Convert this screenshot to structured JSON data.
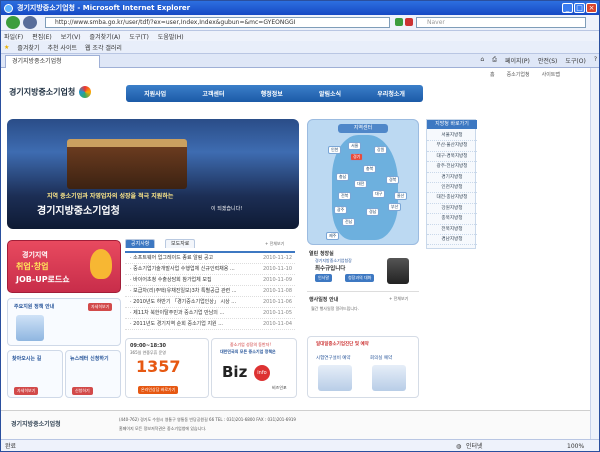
{
  "window": {
    "title": "경기지방중소기업청 - Microsoft Internet Explorer"
  },
  "address": {
    "url": "http://www.smba.go.kr/user/tdf/?ex=user,Index,Index&gubun=&mc=GYEONGGI",
    "search_placeholder": "Naver"
  },
  "menu": [
    "파일(F)",
    "편집(E)",
    "보기(V)",
    "즐겨찾기(A)",
    "도구(T)",
    "도움말(H)"
  ],
  "favbar": {
    "favorites": "즐겨찾기",
    "suggested": "추천 사이트",
    "webslice": "웹 조각 갤러리"
  },
  "tab": {
    "title": "경기지방중소기업청"
  },
  "ietools": [
    "페이지(P)",
    "안전(S)",
    "도구(O)"
  ],
  "page": {
    "toplinks": [
      "홈",
      "중소기업청",
      "사이트맵"
    ],
    "logo": "경기지방중소기업청",
    "gnb": [
      "지원사업",
      "고객센터",
      "행정정보",
      "알림소식",
      "우리청소개"
    ],
    "hero": {
      "caption1": "지역 중소기업과 자영업자의 성장을 적극 지원하는",
      "caption2": "경기지방중소기업청",
      "caption3": "이 되겠습니다!"
    },
    "map": {
      "title": "지역센터",
      "regions": [
        "인천",
        "서울",
        "경기",
        "강원",
        "충북",
        "충남",
        "대전",
        "전북",
        "대구",
        "경북",
        "부산",
        "광주",
        "전남",
        "제주",
        "울산",
        "경남"
      ]
    },
    "sidebar": {
      "title": "지방청 바로가기",
      "items": [
        "서울지방청",
        "부산·울산지방청",
        "대구·경북지방청",
        "광주·전남지방청",
        "경기지방청",
        "인천지방청",
        "대전·충남지방청",
        "강원지방청",
        "충북지방청",
        "전북지방청",
        "경남지방청"
      ]
    },
    "banner": {
      "line1": "경기지역",
      "line2": "취업·창업",
      "line3": "JOB-UP로드쇼"
    },
    "notice": {
      "tabs": [
        "공지사항",
        "보도자료"
      ],
      "more": "+ 전체보기",
      "rows": [
        {
          "title": "· 소프트웨어 업그레이드 종료 알림 공고",
          "date": "2010-11-12"
        },
        {
          "title": "· 중소기업기술개발사업 수행업체 신규인력채용 ...",
          "date": "2010-11-10"
        },
        {
          "title": "· 바이어초청 수출상담회 참가업체 모집",
          "date": "2010-11-09"
        },
        {
          "title": "· 보급차(리)주택(유채진일보)3차 특별공급 관련 ...",
          "date": "2010-11-08"
        },
        {
          "title": "· 2010년도 하반기 「경기중소기업인상」 시상 ...",
          "date": "2010-11-06"
        },
        {
          "title": "· 제11차 북한이탈주민과 중소기업 만남의 ...",
          "date": "2010-11-05"
        },
        {
          "title": "· 2011년도 경기지역 순회 중소기업 지원 ...",
          "date": "2010-11-04"
        }
      ]
    },
    "card1": {
      "title": "주요지원 정책 안내",
      "more": "자세히보기"
    },
    "card2": {
      "title": "찾아오시는 길",
      "btn": "자세히보기"
    },
    "card3": {
      "title": "뉴스레터 신청하기",
      "btn": "신청하기"
    },
    "call": {
      "hours": "09:00~18:30",
      "sub": "365일 연중무휴 운영",
      "number": "1357",
      "btn": "온라인상담 바로가기"
    },
    "biz": {
      "line1": "중소기업 성장의 동반자!",
      "line2": "대한민국의 모든 중소기업 정책은",
      "logo": "Biz",
      "badge": "info",
      "sub": "비즈인포"
    },
    "person": {
      "title": "열린 청장실",
      "name": "최수규입니다",
      "role": "경기지방중소기업청장",
      "btn1": "인사말",
      "btn2": "청장과의 대화"
    },
    "schedule": {
      "title": "행사일정 안내",
      "more": "+ 전체보기",
      "row": "월간 행사일정 알려드립니다."
    },
    "support": {
      "title": "일대일중소기업진단 및 예약",
      "left": "시험연구설비 예약",
      "right": "회의실 예약"
    },
    "footer": {
      "logo": "경기지방중소기업청",
      "addr": "(440-762) 경기도 수원시 영통구 영통동 빈당공원길 66   TEL : 031)201-6800   FAX : 031)201-6919",
      "copy": "홈페이지 모든 정보저작권은 중소기업청에 있습니다."
    }
  },
  "status": {
    "left": "완료",
    "zone": "인터넷",
    "zoom": "100%"
  }
}
